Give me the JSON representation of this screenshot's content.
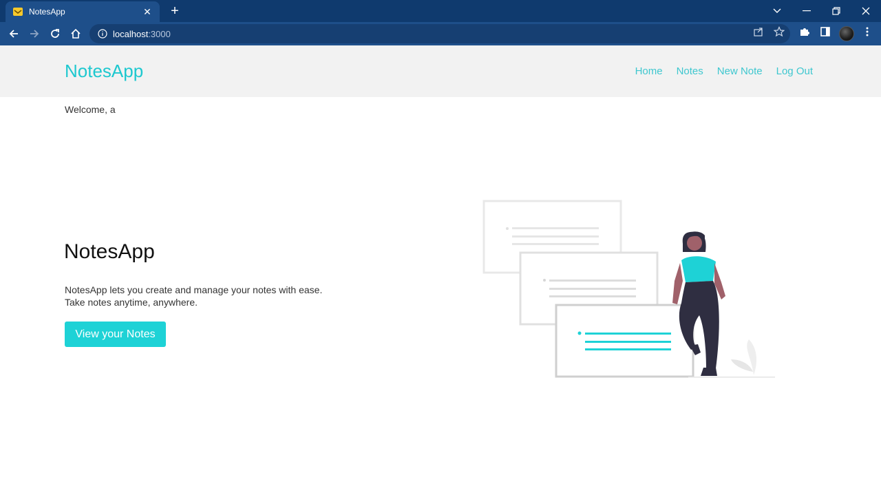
{
  "browser": {
    "tab_title": "NotesApp",
    "url_host": "localhost",
    "url_port": ":3000",
    "accent": "#0f3a6e"
  },
  "nav": {
    "brand": "NotesApp",
    "links": [
      "Home",
      "Notes",
      "New Note",
      "Log Out"
    ]
  },
  "welcome": "Welcome, a",
  "hero": {
    "title": "NotesApp",
    "desc_line1": "NotesApp lets you create and manage your notes with ease.",
    "desc_line2": "Take notes anytime, anywhere.",
    "button": "View your Notes"
  },
  "colors": {
    "brand": "#1ec8cf",
    "button": "#1ed2d6"
  }
}
